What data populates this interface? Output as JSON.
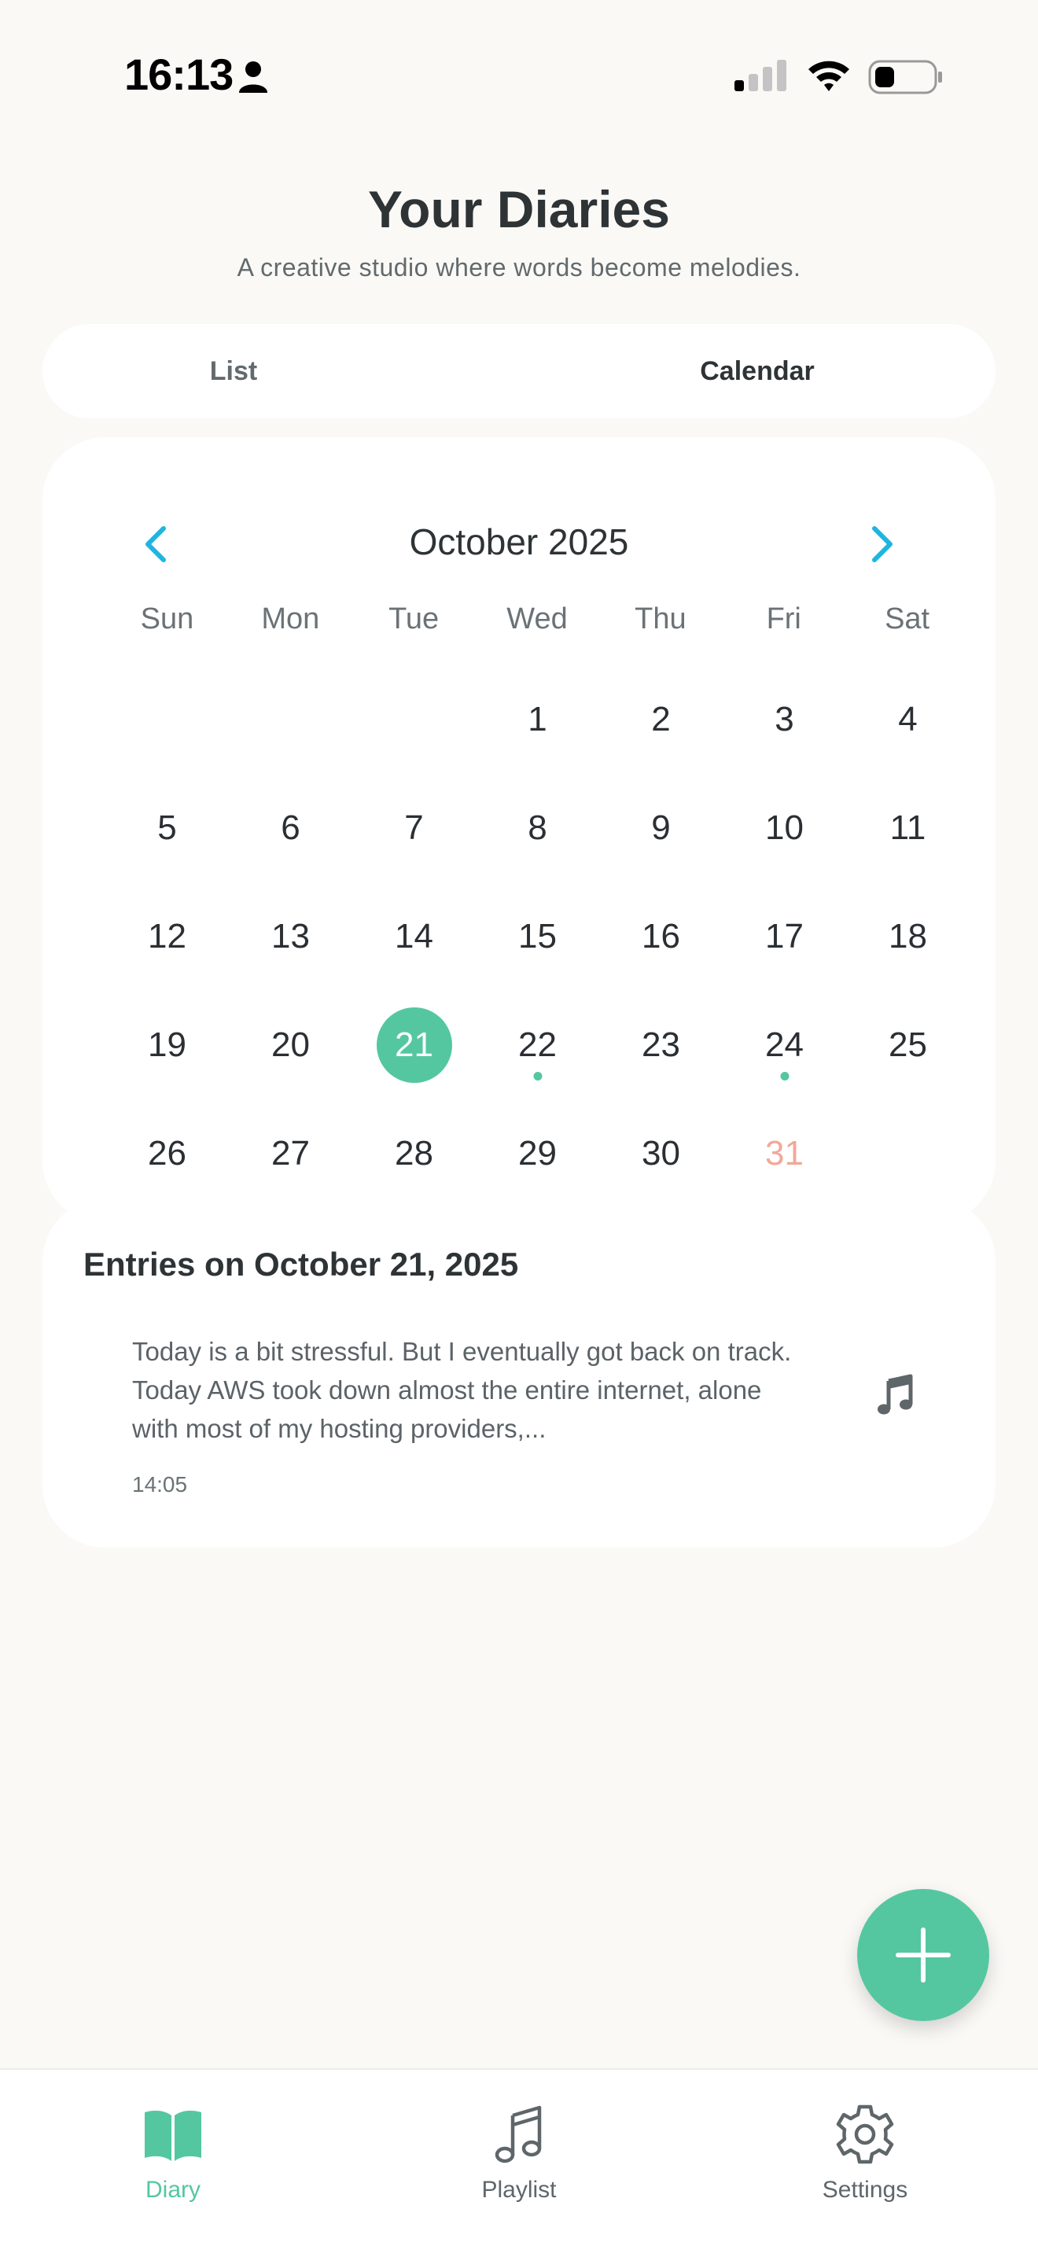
{
  "status_bar": {
    "time": "16:13"
  },
  "header": {
    "title": "Your Diaries",
    "subtitle": "A creative studio where words become melodies."
  },
  "segmented": {
    "list_label": "List",
    "calendar_label": "Calendar",
    "selected": "Calendar"
  },
  "calendar": {
    "month_label": "October 2025",
    "weekdays": [
      "Sun",
      "Mon",
      "Tue",
      "Wed",
      "Thu",
      "Fri",
      "Sat"
    ],
    "days": [
      "",
      "",
      "",
      "1",
      "2",
      "3",
      "4",
      "5",
      "6",
      "7",
      "8",
      "9",
      "10",
      "11",
      "12",
      "13",
      "14",
      "15",
      "16",
      "17",
      "18",
      "19",
      "20",
      "21",
      "22",
      "23",
      "24",
      "25",
      "26",
      "27",
      "28",
      "29",
      "30",
      "31",
      ""
    ],
    "selected_day": "21",
    "days_with_entries": [
      "22",
      "24"
    ],
    "highlighted_day": "31"
  },
  "entries": {
    "title": "Entries on October 21, 2025",
    "items": [
      {
        "text": "Today is a bit stressful. But I eventually got back on track. Today AWS took down almost the entire internet, alone with  most of my hosting providers,...",
        "time": "14:05"
      }
    ]
  },
  "tab_bar": {
    "diary_label": "Diary",
    "playlist_label": "Playlist",
    "settings_label": "Settings",
    "active": "Diary"
  },
  "colors": {
    "accent": "#54c7a1",
    "background": "#faf9f6",
    "arrow": "#1fb5e0",
    "muted_day": "#f2a89a"
  }
}
